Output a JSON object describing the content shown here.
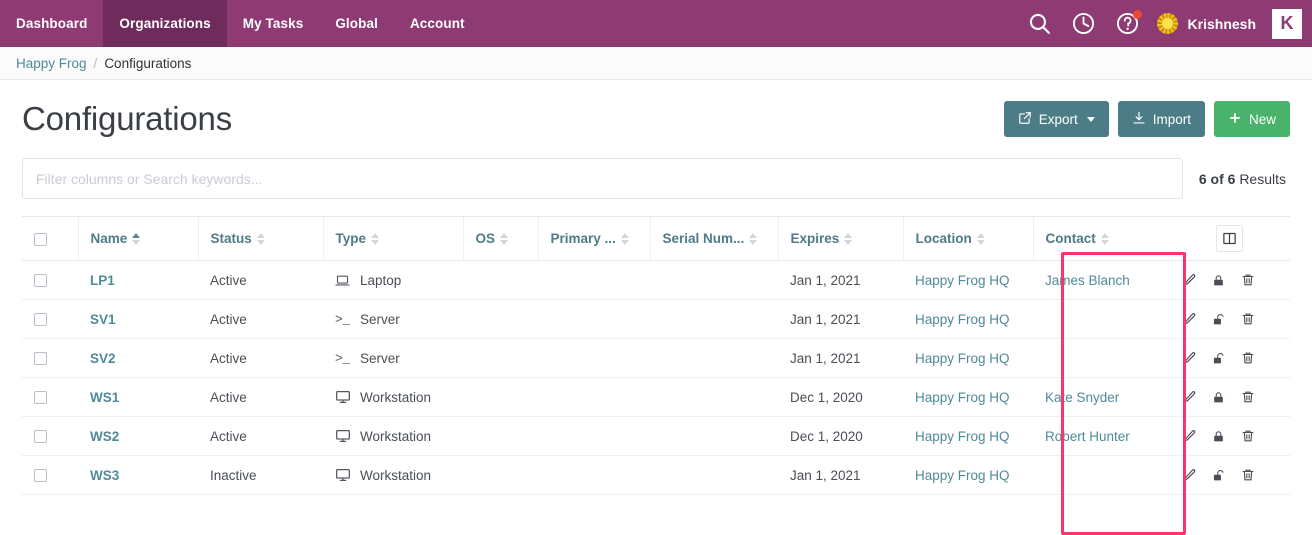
{
  "topnav": {
    "items": [
      {
        "label": "Dashboard",
        "active": false
      },
      {
        "label": "Organizations",
        "active": true
      },
      {
        "label": "My Tasks",
        "active": false
      },
      {
        "label": "Global",
        "active": false
      },
      {
        "label": "Account",
        "active": false
      }
    ],
    "icons": [
      "search-icon",
      "history-clock-icon",
      "help-question-icon"
    ],
    "username": "Krishnesh",
    "logo_letter": "K",
    "notification_dot": true,
    "bar_color": "#8e3a73",
    "active_tab_color": "#6f2b5b"
  },
  "breadcrumb": {
    "parent": "Happy Frog",
    "separator": "/",
    "current": "Configurations"
  },
  "page": {
    "title": "Configurations"
  },
  "toolbar": {
    "export_label": "Export",
    "import_label": "Import",
    "new_label": "New",
    "teal_color": "#4c7d87",
    "green_color": "#49b36b"
  },
  "filter": {
    "placeholder": "Filter columns or Search keywords...",
    "value": "",
    "results_count": "6 of 6",
    "results_label": "Results"
  },
  "table": {
    "select_all": false,
    "columns": [
      {
        "label": "Name",
        "sorted": "asc"
      },
      {
        "label": "Status",
        "sorted": "none"
      },
      {
        "label": "Type",
        "sorted": "none"
      },
      {
        "label": "OS",
        "sorted": "none"
      },
      {
        "label": "Primary ...",
        "sorted": "none"
      },
      {
        "label": "Serial Num...",
        "sorted": "none"
      },
      {
        "label": "Expires",
        "sorted": "none"
      },
      {
        "label": "Location",
        "sorted": "none"
      },
      {
        "label": "Contact",
        "sorted": "none"
      }
    ],
    "column_picker_icon": "columns-layout-icon",
    "rows": [
      {
        "name": "LP1",
        "status": "Active",
        "type": "Laptop",
        "type_icon": "laptop-icon",
        "os": "",
        "primary": "",
        "serial": "",
        "expires": "Jan 1, 2021",
        "location": "Happy Frog HQ",
        "contact": "James Blanch",
        "locked": true
      },
      {
        "name": "SV1",
        "status": "Active",
        "type": "Server",
        "type_icon": "terminal-icon",
        "os": "",
        "primary": "",
        "serial": "",
        "expires": "Jan 1, 2021",
        "location": "Happy Frog HQ",
        "contact": "",
        "locked": false
      },
      {
        "name": "SV2",
        "status": "Active",
        "type": "Server",
        "type_icon": "terminal-icon",
        "os": "",
        "primary": "",
        "serial": "",
        "expires": "Jan 1, 2021",
        "location": "Happy Frog HQ",
        "contact": "",
        "locked": false
      },
      {
        "name": "WS1",
        "status": "Active",
        "type": "Workstation",
        "type_icon": "desktop-icon",
        "os": "",
        "primary": "",
        "serial": "",
        "expires": "Dec 1, 2020",
        "location": "Happy Frog HQ",
        "contact": "Kate Snyder",
        "locked": true
      },
      {
        "name": "WS2",
        "status": "Active",
        "type": "Workstation",
        "type_icon": "desktop-icon",
        "os": "",
        "primary": "",
        "serial": "",
        "expires": "Dec 1, 2020",
        "location": "Happy Frog HQ",
        "contact": "Robert Hunter",
        "locked": true
      },
      {
        "name": "WS3",
        "status": "Inactive",
        "type": "Workstation",
        "type_icon": "desktop-icon",
        "os": "",
        "primary": "",
        "serial": "",
        "expires": "Jan 1, 2021",
        "location": "Happy Frog HQ",
        "contact": "",
        "locked": false
      }
    ],
    "row_actions": [
      "edit-pencil-icon",
      "lock-icon",
      "delete-trash-icon"
    ]
  },
  "annotation": {
    "highlight_color": "#f9366b",
    "target_column": "Contact"
  }
}
